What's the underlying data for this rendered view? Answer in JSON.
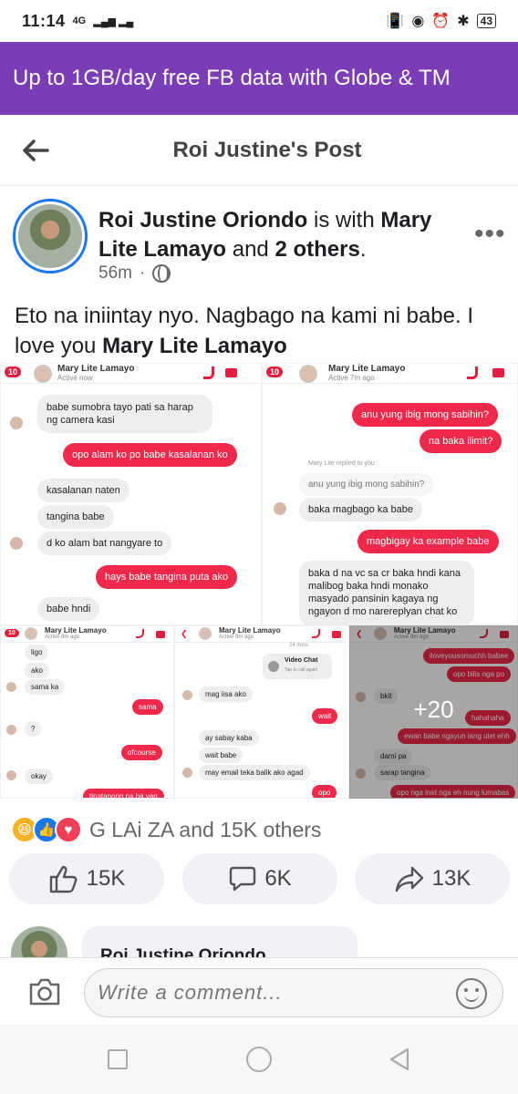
{
  "status_bar": {
    "time": "11:14",
    "signal": "4G",
    "battery": "43"
  },
  "promo_banner": "Up to 1GB/day free FB data with Globe & TM",
  "header": {
    "title": "Roi Justine's Post"
  },
  "post": {
    "author": "Roi Justine Oriondo",
    "with_text": "is with",
    "tagged": "Mary",
    "tagged2": "Lite Lamayo",
    "and": "and",
    "others": "2 others",
    "period": ".",
    "time": "56m",
    "dot": "·",
    "caption_text": "Eto na iniintay nyo. Nagbago na kami ni babe. I love you",
    "caption_tag": "Mary Lite Lamayo"
  },
  "screenshots": {
    "a": {
      "badge": "10",
      "name": "Mary Lite Lamayo",
      "status": "Active now",
      "m1": "babe sumobra tayo pati sa harap",
      "m1b": "ng camera kasi",
      "m2": "opo alam ko po babe kasalanan ko",
      "m3": "kasalanan naten",
      "m4": "tangina babe",
      "m5": "d ko alam bat nangyare to",
      "m6": "hays babe tangina puta ako",
      "m7": "babe hndi"
    },
    "b": {
      "badge": "10",
      "name": "Mary Lite Lamayo",
      "status": "Active 7m ago",
      "m1": "anu yung ibig mong sabihin?",
      "m2": "na baka ilimit?",
      "reply_note": "Mary Lite replied to you",
      "m3": "anu yung ibig mong sabihin?",
      "m4": "baka magbago ka babe",
      "m5": "magbigay ka example babe",
      "m6": "baka d na vc sa cr baka hndi kana malibog baka hndi monako masyado pansinin kagaya ng ngayon d mo narereplyan chat ko"
    },
    "c": {
      "badge": "10",
      "name": "Mary Lite Lamayo",
      "status": "Active 8m ago",
      "m1": "ligo",
      "m2": "ako",
      "m3": "sama ka",
      "m4": "sama",
      "m5": "?",
      "m6": "ofcourse",
      "m7": "okay",
      "m8": "tinatanong pa ba yan"
    },
    "d": {
      "name": "Mary Lite Lamayo",
      "status": "Active 8m ago",
      "duration": "24 mins",
      "video_chat": "Video Chat",
      "tap": "Tap to call again",
      "m1": "mag iisa ako",
      "m2": "wait",
      "m3": "ay sabay kaba",
      "m4": "wait babe",
      "m5": "may email teka balik ako agad",
      "m6": "opo"
    },
    "e": {
      "name": "Mary Lite Lamayo",
      "status": "Active 8m ago",
      "m1": "iloveyousomuchh babee",
      "m2": "opo bilis nga po",
      "m3": "bkit",
      "m4": "hahahaha",
      "m5": "ewan babe ngayun lang ulet ehh",
      "m6": "dami pa",
      "m7": "sarap tangina",
      "m8": "opo nga inet nga eh nung lumabas"
    },
    "more_count": "+20"
  },
  "reactions": {
    "summary": "G LAi ZA and 15K others"
  },
  "actions": {
    "like": "15K",
    "comment": "6K",
    "share": "13K"
  },
  "comment": {
    "author": "Roi Justine Oriondo"
  },
  "composer": {
    "placeholder": "Write a comment..."
  },
  "colors": {
    "promo": "#7b3db5",
    "messenger_red": "#f0284a",
    "fb_blue": "#1877f2"
  }
}
